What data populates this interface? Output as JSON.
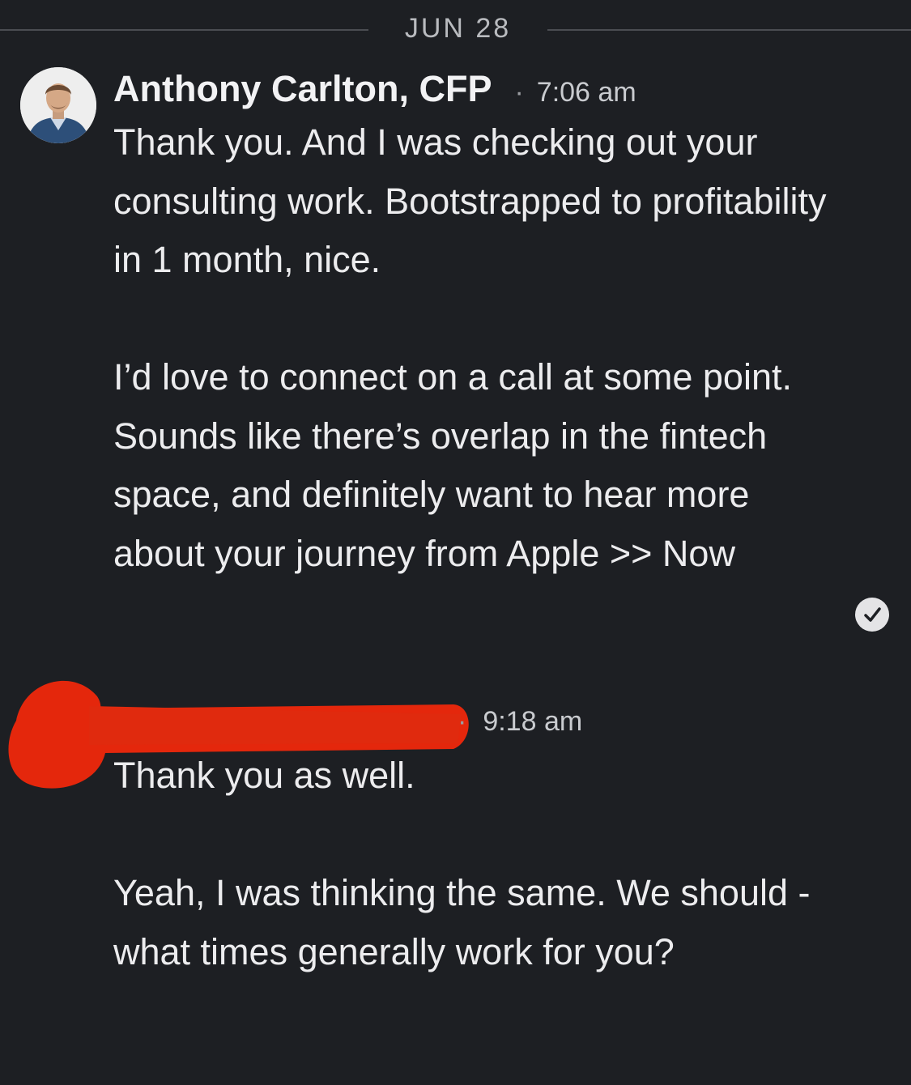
{
  "conversation": {
    "date_divider": "JUN 28",
    "messages": [
      {
        "sender": "Anthony Carlton, CFP",
        "time": "7:06 am",
        "separator": "·",
        "paragraphs": [
          "Thank you. And I was checking out your consulting work. Bootstrapped to profitability in 1 month, nice.",
          "I’d love to connect on a call at some point. Sounds like there’s overlap in the fintech space, and definitely want to hear more about your journey from Apple >> Now"
        ],
        "read_icon": "checkmark-circle-icon"
      },
      {
        "sender_redacted": true,
        "time": "9:18 am",
        "separator": "·",
        "paragraphs": [
          "Thank you as well.",
          "Yeah, I was thinking the same.  We should - what times generally work for you?"
        ]
      }
    ]
  },
  "colors": {
    "background": "#1d1f23",
    "text": "#ececee",
    "redaction": "#e4270c"
  }
}
